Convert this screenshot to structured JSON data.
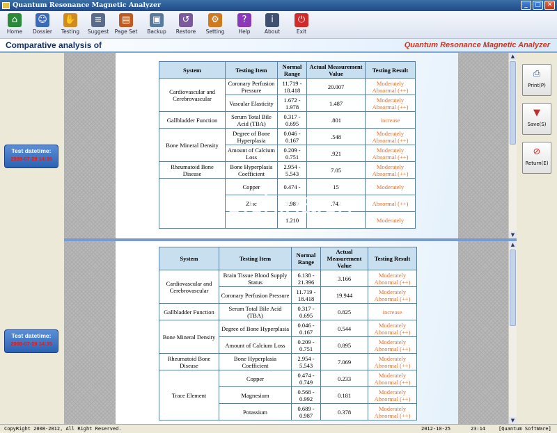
{
  "window": {
    "title": "Quantum Resonance Magnetic Analyzer"
  },
  "toolbar": [
    {
      "label": "Home",
      "icon": "home-icon",
      "color": "#2a8a3a"
    },
    {
      "label": "Dossier",
      "icon": "people-icon",
      "color": "#3a6ab8"
    },
    {
      "label": "Testing",
      "icon": "hand-icon",
      "color": "#d08a20"
    },
    {
      "label": "Suggest",
      "icon": "document-icon",
      "color": "#5a6a8a"
    },
    {
      "label": "Page Set",
      "icon": "page-set-icon",
      "color": "#c05a20"
    },
    {
      "label": "Backup",
      "icon": "backup-icon",
      "color": "#5a7a9a"
    },
    {
      "label": "Restore",
      "icon": "restore-icon",
      "color": "#7a5a9a"
    },
    {
      "label": "Setting",
      "icon": "gears-icon",
      "color": "#d07a20"
    },
    {
      "label": "Help",
      "icon": "help-book-icon",
      "color": "#8a3ab8"
    },
    {
      "label": "About",
      "icon": "about-icon",
      "color": "#405070"
    },
    {
      "label": "Exit",
      "icon": "exit-icon",
      "color": "#d02a2a"
    }
  ],
  "header": {
    "title": "Comparative analysis of",
    "brand": "Quantum Resonance Magnetic Analyzer"
  },
  "test1": {
    "label": "Test datetime:",
    "value": "2008-07-29 14:35"
  },
  "test2": {
    "label": "Test datetime:",
    "value": "2008-07-29 14:35"
  },
  "table1": {
    "headers": [
      "System",
      "Testing Item",
      "Normal Range",
      "Actual Measurement Value",
      "Testing Result"
    ],
    "rows": [
      [
        "Cardiovascular and Cerebrovascular",
        "Coronary Perfusion Pressure",
        "11.719 - 18.418",
        "20.007",
        "Moderately Abnormal (++)"
      ],
      [
        "",
        "Vascular Elasticity",
        "1.672 - 1.978",
        "1.487",
        "Moderately Abnormal (++)"
      ],
      [
        "Gallbladder Function",
        "Serum Total Bile Acid (TBA)",
        "0.317 - 0.695",
        ".801",
        "increase"
      ],
      [
        "Bone Mineral Density",
        "Degree of Bone Hyperplasia",
        "0.046 - 0.167",
        ".548",
        "Moderately Abnormal (++)"
      ],
      [
        "",
        "Amount of Calcium Loss",
        "0.209 - 0.751",
        ".921",
        "Moderately Abnormal (++)"
      ],
      [
        "Rheumatoid Bone Disease",
        "Bone Hyperplasia Coefficient",
        "2.954 - 5.543",
        "7.05",
        "Moderately Abnormal (++)"
      ],
      [
        "",
        "Copper",
        "0.474 -",
        "15",
        "Moderately"
      ],
      [
        "",
        "Zinc",
        "1.989",
        ".742",
        "Abnormal (++)"
      ],
      [
        "",
        "",
        "1.210",
        "",
        "Moderately"
      ]
    ]
  },
  "table2": {
    "headers": [
      "System",
      "Testing Item",
      "Normal Range",
      "Actual Measurement Value",
      "Testing Result"
    ],
    "rows": [
      [
        "Cardiovascular and Cerebrovascular",
        "Brain Tissue Blood Supply Status",
        "6.138 - 21.396",
        "3.166",
        "Moderately Abnormal (++)"
      ],
      [
        "",
        "Coronary Perfusion Pressure",
        "11.719 - 18.418",
        "19.944",
        "Moderately Abnormal (++)"
      ],
      [
        "Gallbladder Function",
        "Serum Total Bile Acid (TBA)",
        "0.317 - 0.695",
        "0.825",
        "increase"
      ],
      [
        "Bone Mineral Density",
        "Degree of Bone Hyperplasia",
        "0.046 - 0.167",
        "0.544",
        "Moderately Abnormal (++)"
      ],
      [
        "",
        "Amount of Calcium Loss",
        "0.209 - 0.751",
        "0.895",
        "Moderately Abnormal (++)"
      ],
      [
        "Rheumatoid Bone Disease",
        "Bone Hyperplasia Coefficient",
        "2.954 - 5.543",
        "7.069",
        "Moderately Abnormal (++)"
      ],
      [
        "Trace Element",
        "Copper",
        "0.474 - 0.749",
        "0.233",
        "Moderately Abnormal (++)"
      ],
      [
        "",
        "Magnesium",
        "0.568 - 0.992",
        "0.181",
        "Moderately Abnormal (++)"
      ],
      [
        "",
        "Potassium",
        "0.689 - 0.987",
        "0.378",
        "Moderately Abnormal (++)"
      ]
    ]
  },
  "side_buttons": [
    {
      "label": "Print(P)",
      "icon": "printer-icon"
    },
    {
      "label": "Save(S)",
      "icon": "save-icon"
    },
    {
      "label": "Return(E)",
      "icon": "return-icon"
    }
  ],
  "status": {
    "copyright": "CopyRight 2008-2012, All Right Reserved.",
    "date": "2012-10-25",
    "time": "23:14",
    "company": "[Quantum SoftWare]"
  },
  "watermark": "trade.china.cn",
  "colors": {
    "abnormal": "#e07030",
    "header_brand": "#d6321b",
    "title": "#12306e"
  }
}
